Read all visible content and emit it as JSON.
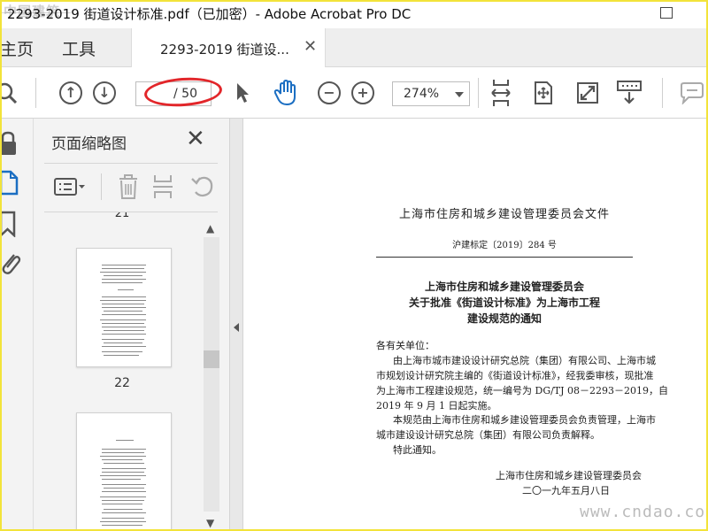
{
  "window": {
    "title": "2293-2019 街道设计标准.pdf（已加密）- Adobe Acrobat Pro DC",
    "watermark_top": "中国建筑"
  },
  "tabs": {
    "home": "主页",
    "tools": "工具",
    "document": "2293-2019 街道设...",
    "close_glyph": "✕"
  },
  "toolbar": {
    "page_current": "",
    "page_total": "/ 50",
    "zoom": "274%"
  },
  "panel": {
    "title": "页面缩略图",
    "close_glyph": "✕",
    "page_above": "21",
    "page_current": "22"
  },
  "document": {
    "header": "上海市住房和城乡建设管理委员会文件",
    "file_no": "沪建标定〔2019〕284 号",
    "notice_title_1": "上海市住房和城乡建设管理委员会",
    "notice_title_2": "关于批准《街道设计标准》为上海市工程",
    "notice_title_3": "建设规范的通知",
    "salutation": "各有关单位：",
    "para1_line1": "由上海市城市建设设计研究总院（集团）有限公司、上海市城",
    "para1_line2": "市规划设计研究院主编的《街道设计标准》，经我委审核，现批准",
    "para1_line3": "为上海市工程建设规范，统一编号为 DG/TJ 08－2293－2019，自",
    "para1_line4": "2019 年 9 月 1 日起实施。",
    "para2_line1": "本规范由上海市住房和城乡建设管理委员会负责管理，上海市",
    "para2_line2": "城市建设设计研究总院（集团）有限公司负责解释。",
    "para3": "特此通知。",
    "sign_org": "上海市住房和城乡建设管理委员会",
    "sign_date": "二〇一九年五月八日"
  },
  "watermark_bottom": "www.cndao.com",
  "colors": {
    "highlight_ellipse": "#e2262a",
    "hand_tool": "#1b6ec2",
    "frame": "#f2e33a"
  }
}
